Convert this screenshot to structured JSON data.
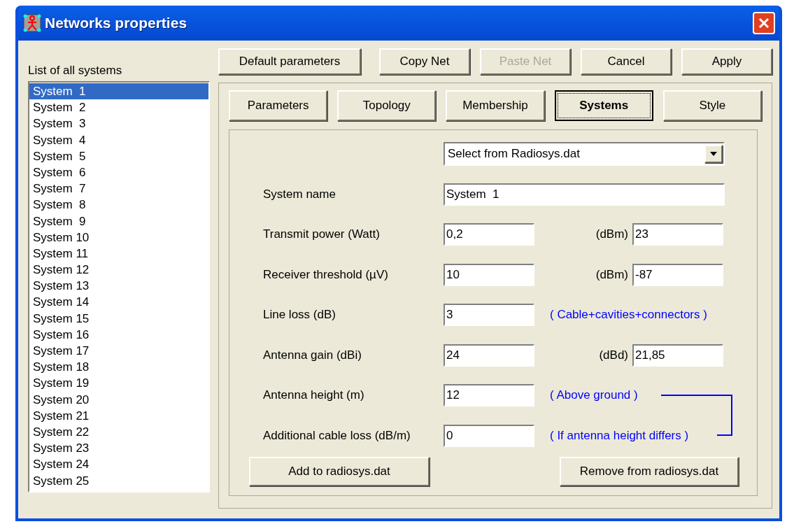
{
  "window": {
    "title": "Networks properties"
  },
  "list": {
    "label": "List of all systems",
    "items": [
      {
        "label": "System  1",
        "selected": true
      },
      {
        "label": "System  2",
        "selected": false
      },
      {
        "label": "System  3",
        "selected": false
      },
      {
        "label": "System  4",
        "selected": false
      },
      {
        "label": "System  5",
        "selected": false
      },
      {
        "label": "System  6",
        "selected": false
      },
      {
        "label": "System  7",
        "selected": false
      },
      {
        "label": "System  8",
        "selected": false
      },
      {
        "label": "System  9",
        "selected": false
      },
      {
        "label": "System 10",
        "selected": false
      },
      {
        "label": "System 11",
        "selected": false
      },
      {
        "label": "System 12",
        "selected": false
      },
      {
        "label": "System 13",
        "selected": false
      },
      {
        "label": "System 14",
        "selected": false
      },
      {
        "label": "System 15",
        "selected": false
      },
      {
        "label": "System 16",
        "selected": false
      },
      {
        "label": "System 17",
        "selected": false
      },
      {
        "label": "System 18",
        "selected": false
      },
      {
        "label": "System 19",
        "selected": false
      },
      {
        "label": "System 20",
        "selected": false
      },
      {
        "label": "System 21",
        "selected": false
      },
      {
        "label": "System 22",
        "selected": false
      },
      {
        "label": "System 23",
        "selected": false
      },
      {
        "label": "System 24",
        "selected": false
      },
      {
        "label": "System 25",
        "selected": false
      }
    ]
  },
  "top_buttons": [
    {
      "label": "Default parameters",
      "disabled": false
    },
    {
      "label": "Copy Net",
      "disabled": false
    },
    {
      "label": "Paste Net",
      "disabled": true
    },
    {
      "label": "Cancel",
      "disabled": false
    },
    {
      "label": "Apply",
      "disabled": false
    }
  ],
  "tabs": [
    {
      "label": "Parameters",
      "selected": false
    },
    {
      "label": "Topology",
      "selected": false
    },
    {
      "label": "Membership",
      "selected": false
    },
    {
      "label": "Systems",
      "selected": true
    },
    {
      "label": "Style",
      "selected": false
    }
  ],
  "fields": [
    {
      "kind": "dropdown",
      "value": "Select from Radiosys.dat"
    },
    {
      "kind": "text",
      "label": "System name",
      "value": "System  1"
    },
    {
      "kind": "pair",
      "label": "Transmit power (Watt)",
      "value": "0,2",
      "unit": "(dBm)",
      "value2": "23"
    },
    {
      "kind": "pair",
      "label": "Receiver threshold (µV)",
      "value": "10",
      "unit": "(dBm)",
      "value2": "-87"
    },
    {
      "kind": "note",
      "label": "Line loss (dB)",
      "value": "3",
      "note": "( Cable+cavities+connectors )"
    },
    {
      "kind": "pair",
      "label": "Antenna gain (dBi)",
      "value": "24",
      "unit": "(dBd)",
      "value2": "21,85"
    },
    {
      "kind": "note",
      "label": "Antenna height (m)",
      "value": "12",
      "note": "( Above ground )"
    },
    {
      "kind": "note",
      "label": "Additional cable loss (dB/m)",
      "value": "0",
      "note": "( If antenna height differs )"
    }
  ],
  "bottom_buttons": [
    "Add to radiosys.dat",
    "Remove from radiosys.dat"
  ]
}
